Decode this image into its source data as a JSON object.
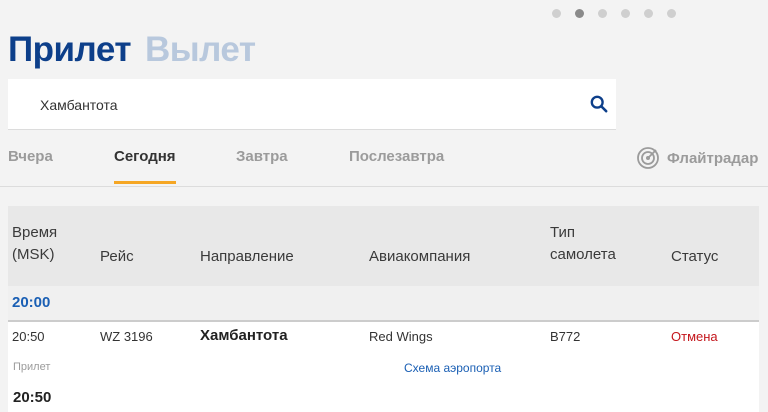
{
  "carousel": {
    "dot_count": 6,
    "active_index": 1
  },
  "header": {
    "active_title": "Прилет",
    "inactive_title": "Вылет"
  },
  "search": {
    "value": "Хамбантота",
    "icon": "search-icon"
  },
  "day_tabs": [
    {
      "label": "Вчера",
      "active": false
    },
    {
      "label": "Сегодня",
      "active": true
    },
    {
      "label": "Завтра",
      "active": false
    },
    {
      "label": "Послезавтра",
      "active": false
    }
  ],
  "flightradar": {
    "label": "Флайтрадар",
    "icon": "radar-icon"
  },
  "table": {
    "headers": {
      "time": "Время\n(MSK)",
      "flight": "Рейс",
      "direction": "Направление",
      "airline": "Авиакомпания",
      "aircraft": "Тип\nсамолета",
      "status": "Статус"
    }
  },
  "groups": [
    {
      "time": "20:00",
      "flights": [
        {
          "time": "20:50",
          "flight": "WZ 3196",
          "direction": "Хамбантота",
          "airline": "Red Wings",
          "aircraft": "B772",
          "status": "Отмена"
        }
      ]
    }
  ],
  "details": {
    "label": "Прилет",
    "map_link": "Схема аэропорта",
    "time": "20:50"
  },
  "colors": {
    "accent_blue": "#0d3f8a",
    "tab_underline": "#f5a623",
    "status_cancelled": "#c4161c"
  }
}
